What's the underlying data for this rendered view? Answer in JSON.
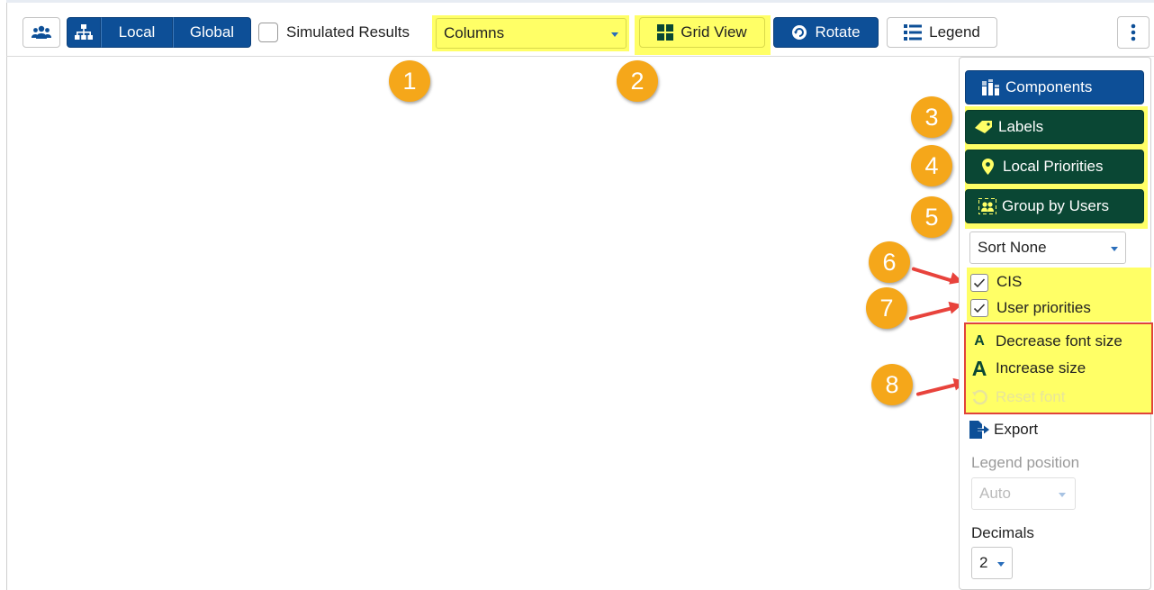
{
  "toolbar": {
    "local_label": "Local",
    "global_label": "Global",
    "simulated_label": "Simulated Results",
    "view_select_value": "Columns",
    "grid_view_label": "Grid View",
    "rotate_label": "Rotate",
    "legend_label": "Legend"
  },
  "annotations": [
    "1",
    "2",
    "3",
    "4",
    "5",
    "6",
    "7",
    "8"
  ],
  "panel": {
    "components_label": "Components",
    "labels_label": "Labels",
    "local_priorities_label": "Local Priorities",
    "group_by_users_label": "Group by Users",
    "sort_value": "Sort None",
    "cis_label": "CIS",
    "user_priorities_label": "User priorities",
    "decrease_font_label": "Decrease font size",
    "increase_size_label": "Increase size",
    "reset_font_label": "Reset font",
    "export_label": "Export",
    "legend_position_label": "Legend position",
    "legend_position_value": "Auto",
    "decimals_label": "Decimals",
    "decimals_value": "2"
  },
  "colors": {
    "primary_blue": "#0d4f97",
    "dark_green": "#0a4734",
    "highlight_yellow": "#ffff66",
    "badge_orange": "#f5a71a",
    "arrow_red": "#e8433c"
  }
}
